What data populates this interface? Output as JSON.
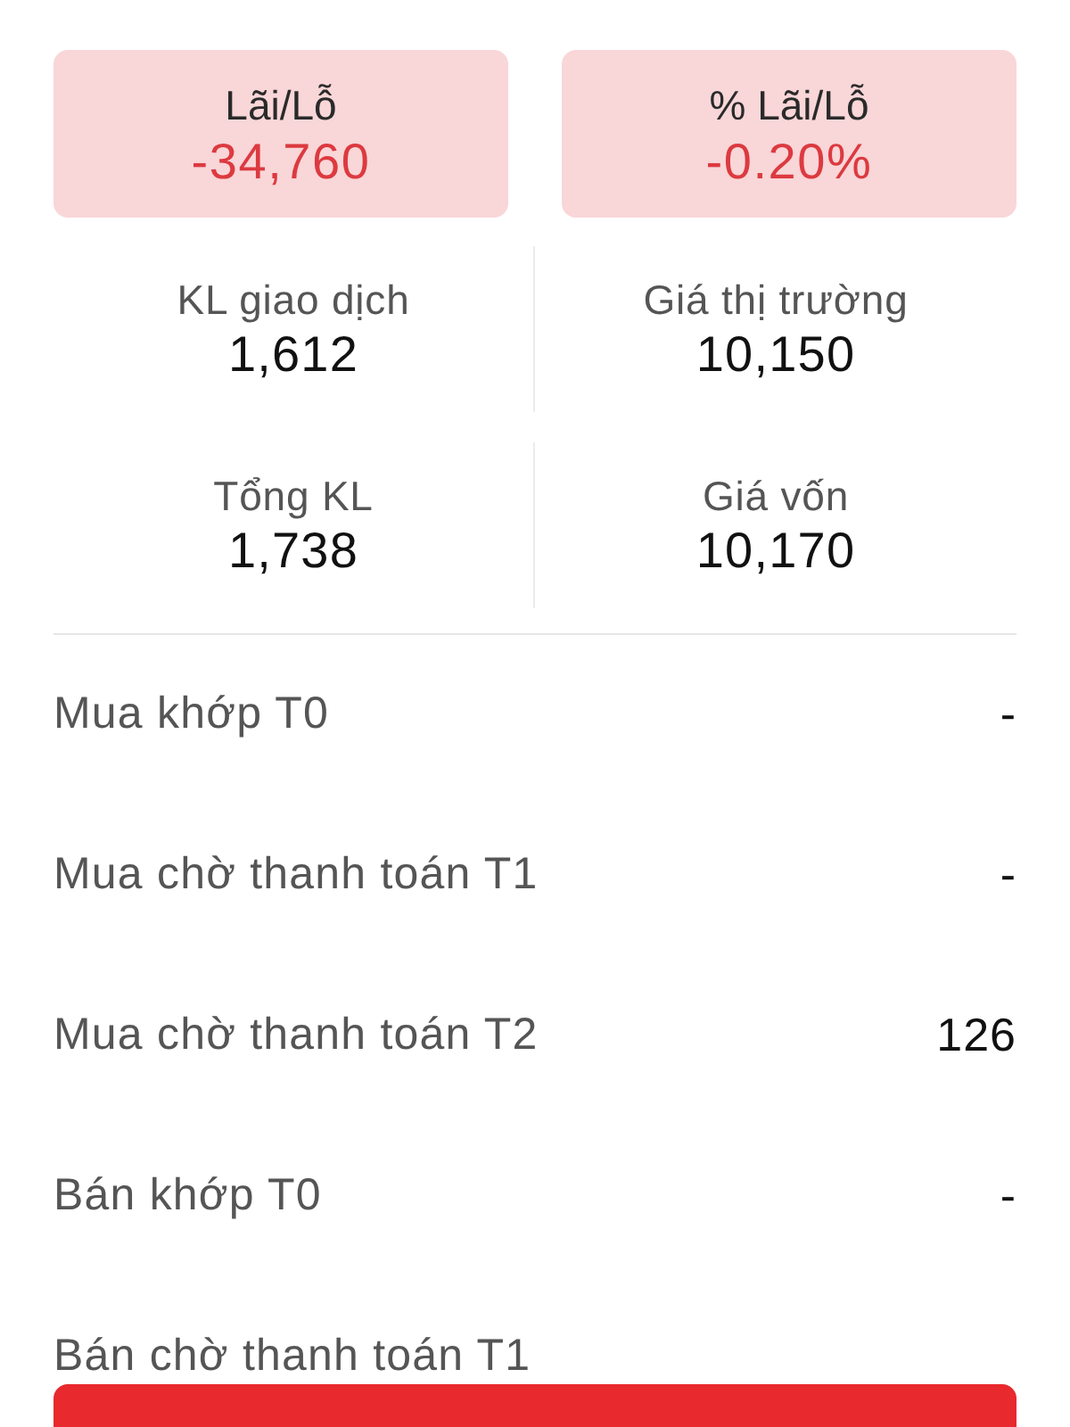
{
  "summary_cards": [
    {
      "label": "Lãi/Lỗ",
      "value": "-34,760",
      "negative": true
    },
    {
      "label": "% Lãi/Lỗ",
      "value": "-0.20%",
      "negative": true
    }
  ],
  "stats": [
    {
      "label": "KL giao dịch",
      "value": "1,612"
    },
    {
      "label": "Giá thị trường",
      "value": "10,150"
    },
    {
      "label": "Tổng KL",
      "value": "1,738"
    },
    {
      "label": "Giá vốn",
      "value": "10,170"
    }
  ],
  "rows": [
    {
      "label": "Mua khớp T0",
      "value": "-"
    },
    {
      "label": "Mua chờ thanh toán T1",
      "value": "-"
    },
    {
      "label": "Mua chờ thanh toán T2",
      "value": "126"
    },
    {
      "label": "Bán khớp T0",
      "value": "-"
    },
    {
      "label": "Bán chờ thanh toán T1"
    }
  ]
}
